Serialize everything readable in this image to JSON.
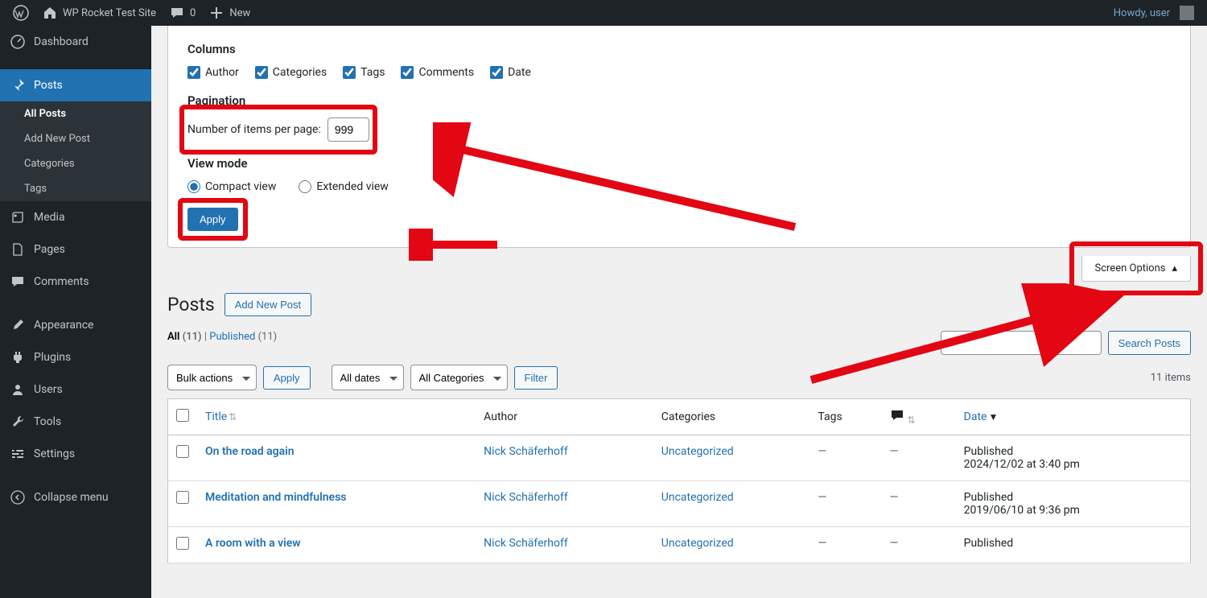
{
  "adminbar": {
    "site_title": "WP Rocket Test Site",
    "comment_count": "0",
    "new_label": "New",
    "howdy": "Howdy, user"
  },
  "sidebar": {
    "dashboard": "Dashboard",
    "posts": "Posts",
    "posts_sub": {
      "all": "All Posts",
      "addnew": "Add New Post",
      "categories": "Categories",
      "tags": "Tags"
    },
    "media": "Media",
    "pages": "Pages",
    "comments": "Comments",
    "appearance": "Appearance",
    "plugins": "Plugins",
    "users": "Users",
    "tools": "Tools",
    "settings": "Settings",
    "collapse": "Collapse menu"
  },
  "screen_options": {
    "columns_heading": "Columns",
    "cols": {
      "author": "Author",
      "categories": "Categories",
      "tags": "Tags",
      "comments": "Comments",
      "date": "Date"
    },
    "pagination_heading": "Pagination",
    "per_page_label": "Number of items per page:",
    "per_page_value": "999",
    "viewmode_heading": "View mode",
    "view_compact": "Compact view",
    "view_extended": "Extended view",
    "apply": "Apply",
    "tab_label": "Screen Options"
  },
  "page": {
    "title": "Posts",
    "add_new": "Add New Post"
  },
  "subsubsub": {
    "all_label": "All",
    "all_count": "(11)",
    "sep": "|",
    "published_label": "Published",
    "published_count": "(11)"
  },
  "search_button": "Search Posts",
  "bulk": {
    "label": "Bulk actions",
    "apply": "Apply"
  },
  "filters": {
    "dates": "All dates",
    "categories": "All Categories",
    "filter": "Filter"
  },
  "item_count": "11 items",
  "table": {
    "headers": {
      "title": "Title",
      "author": "Author",
      "categories": "Categories",
      "tags": "Tags",
      "date": "Date"
    },
    "rows": [
      {
        "title": "On the road again",
        "author": "Nick Schäferhoff",
        "categories": "Uncategorized",
        "tags": "—",
        "comments": "—",
        "status": "Published",
        "timestamp": "2024/12/02 at 3:40 pm"
      },
      {
        "title": "Meditation and mindfulness",
        "author": "Nick Schäferhoff",
        "categories": "Uncategorized",
        "tags": "—",
        "comments": "—",
        "status": "Published",
        "timestamp": "2019/06/10 at 9:36 pm"
      },
      {
        "title": "A room with a view",
        "author": "Nick Schäferhoff",
        "categories": "Uncategorized",
        "tags": "—",
        "comments": "—",
        "status": "Published",
        "timestamp": ""
      }
    ]
  }
}
